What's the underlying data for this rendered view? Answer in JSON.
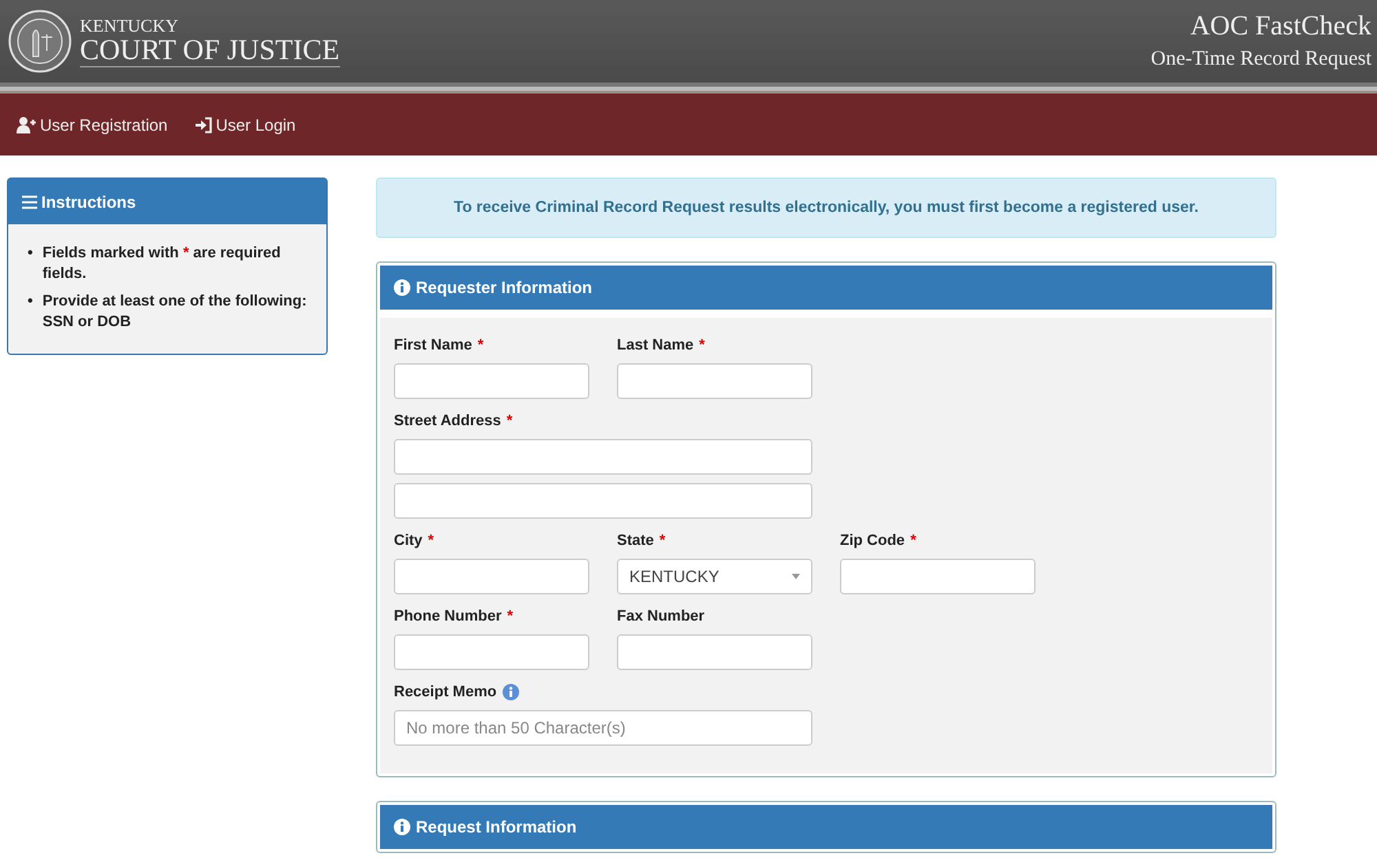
{
  "header": {
    "brand_small": "KENTUCKY",
    "brand_large": "COURT OF JUSTICE",
    "app_title": "AOC FastCheck",
    "app_subtitle": "One-Time Record Request"
  },
  "nav": [
    {
      "kind": "register",
      "label": "User Registration"
    },
    {
      "kind": "login",
      "label": "User Login"
    }
  ],
  "instructions": {
    "title": "Instructions",
    "items": [
      {
        "bullet": "•",
        "before": "Fields marked with",
        "mark": "*",
        "after": "are required fields."
      },
      {
        "bullet": "•",
        "before": "Provide at least one of the following: SSN or DOB"
      }
    ]
  },
  "alert": "To receive Criminal Record Request results electronically, you must first become a registered user.",
  "sections": [
    {
      "title": "Requester Information",
      "rows": [
        [
          {
            "label": "First Name",
            "required_mark": "*",
            "kind": "text"
          },
          {
            "label": "Last Name",
            "required_mark": "*",
            "kind": "text"
          }
        ],
        [
          {
            "label": "Street Address",
            "required_mark": "*",
            "kind": "address"
          }
        ],
        [
          {
            "label": "City",
            "required_mark": "*",
            "kind": "text"
          },
          {
            "label": "State",
            "required_mark": "*",
            "kind": "select",
            "value": "KENTUCKY"
          },
          {
            "label": "Zip Code",
            "required_mark": "*",
            "kind": "text"
          }
        ],
        [
          {
            "label": "Phone Number",
            "required_mark": "*",
            "kind": "text"
          },
          {
            "label": "Fax Number",
            "kind": "text"
          }
        ],
        [
          {
            "label": "Receipt Memo",
            "info": true,
            "kind": "memo",
            "placeholder": "No more than 50 Character(s)"
          }
        ]
      ]
    },
    {
      "title": "Request Information"
    }
  ]
}
